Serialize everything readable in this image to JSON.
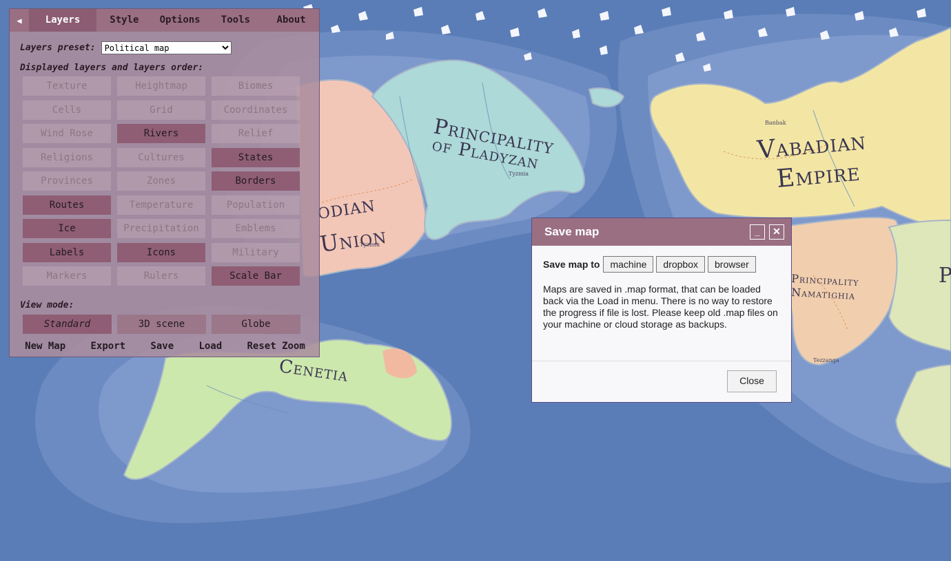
{
  "map": {
    "states": [
      {
        "name_line1": "Principality",
        "name_line2": "of Pladyzan"
      },
      {
        "name_line1": "Vabadian",
        "name_line2": "Empire"
      },
      {
        "name_line1": "odian",
        "name_line2": "Union"
      },
      {
        "name_line1": "Cenetia"
      },
      {
        "name_line1": "Principality",
        "name_line2": "Namatighia"
      },
      {
        "name_line1": "P"
      }
    ],
    "towns": [
      "Tyzmia",
      "Tyzmia",
      "Banbak",
      "Tezzanga"
    ]
  },
  "menu": {
    "tabs": [
      "Layers",
      "Style",
      "Options",
      "Tools",
      "About"
    ],
    "active_tab": "Layers",
    "preset_label": "Layers preset:",
    "preset_value": "Political map",
    "layers_label": "Displayed layers and layers order:",
    "layers": [
      {
        "label": "Texture",
        "on": false
      },
      {
        "label": "Heightmap",
        "on": false
      },
      {
        "label": "Biomes",
        "on": false
      },
      {
        "label": "Cells",
        "on": false
      },
      {
        "label": "Grid",
        "on": false
      },
      {
        "label": "Coordinates",
        "on": false
      },
      {
        "label": "Wind Rose",
        "on": false
      },
      {
        "label": "Rivers",
        "on": true
      },
      {
        "label": "Relief",
        "on": false
      },
      {
        "label": "Religions",
        "on": false
      },
      {
        "label": "Cultures",
        "on": false
      },
      {
        "label": "States",
        "on": true
      },
      {
        "label": "Provinces",
        "on": false
      },
      {
        "label": "Zones",
        "on": false
      },
      {
        "label": "Borders",
        "on": true
      },
      {
        "label": "Routes",
        "on": true
      },
      {
        "label": "Temperature",
        "on": false
      },
      {
        "label": "Population",
        "on": false
      },
      {
        "label": "Ice",
        "on": true
      },
      {
        "label": "Precipitation",
        "on": false
      },
      {
        "label": "Emblems",
        "on": false
      },
      {
        "label": "Labels",
        "on": true
      },
      {
        "label": "Icons",
        "on": true
      },
      {
        "label": "Military",
        "on": false
      },
      {
        "label": "Markers",
        "on": false
      },
      {
        "label": "Rulers",
        "on": false
      },
      {
        "label": "Scale Bar",
        "on": true
      }
    ],
    "view_mode_label": "View mode:",
    "view_modes": [
      "Standard",
      "3D scene",
      "Globe"
    ],
    "active_view": "Standard",
    "bottom_actions": [
      "New Map",
      "Export",
      "Save",
      "Load",
      "Reset Zoom"
    ]
  },
  "dialog": {
    "title": "Save map",
    "minimize_glyph": "_",
    "close_glyph": "✕",
    "save_to_label": "Save map to",
    "targets": [
      "machine",
      "dropbox",
      "browser"
    ],
    "description": "Maps are saved in .map format, that can be loaded back via the Load in menu. There is no way to restore the progress if file is lost. Please keep old .map files on your machine or cloud storage as backups.",
    "close_label": "Close"
  },
  "colors": {
    "ocean": "#5c7fb8",
    "panel_header": "#9a6f82",
    "layer_on": "#8f5e74",
    "dialog_border": "#5a4e86"
  }
}
